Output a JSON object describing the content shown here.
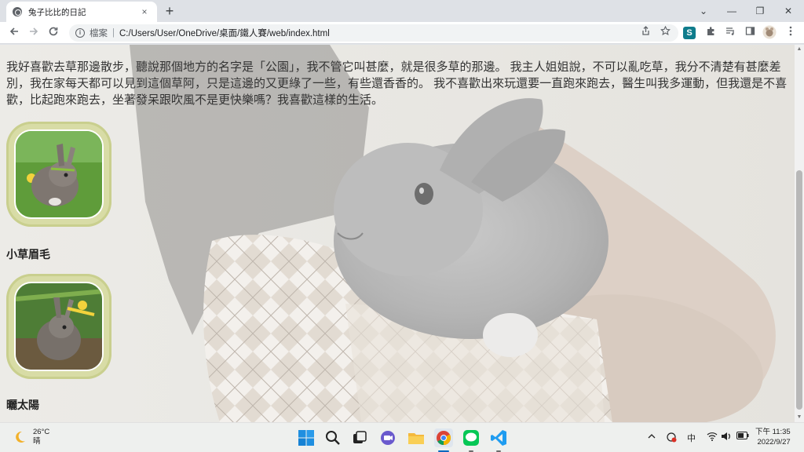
{
  "browser": {
    "tab_title": "兔子比比的日記",
    "tab_close": "×",
    "new_tab": "+",
    "address": {
      "scheme_label": "檔案",
      "separator": "|",
      "url": "C:/Users/User/OneDrive/桌面/鐵人賽/web/index.html"
    },
    "window_controls": {
      "tab_search": "⌄",
      "minimize": "—",
      "restore": "❐",
      "close": "✕"
    },
    "extensions": {
      "s_ext": "S"
    }
  },
  "page": {
    "story": "我好喜歡去草那邊散步，聽說那個地方的名字是「公園」，我不管它叫甚麼，就是很多草的那邊。 我主人姐姐說，不可以亂吃草，我分不清楚有甚麼差別，我在家每天都可以見到這個草阿，只是這邊的又更綠了一些，有些還香香的。 我不喜歡出來玩還要一直跑來跑去，醫生叫我多運動，但我還是不喜歡，比起跑來跑去，坐著發呆跟吹風不是更快樂嗎？我喜歡這樣的生活。",
    "cards": [
      {
        "caption": "小草眉毛"
      },
      {
        "caption": "曬太陽"
      }
    ]
  },
  "taskbar": {
    "weather_temp": "26°C",
    "weather_desc": "晴",
    "ime": "中",
    "time": "下午 11:35",
    "date": "2022/9/27"
  },
  "colors": {
    "card_frame": "#d8dca6",
    "card_ring": "#c9cf8e",
    "ext_s": "#0f7c8c"
  }
}
